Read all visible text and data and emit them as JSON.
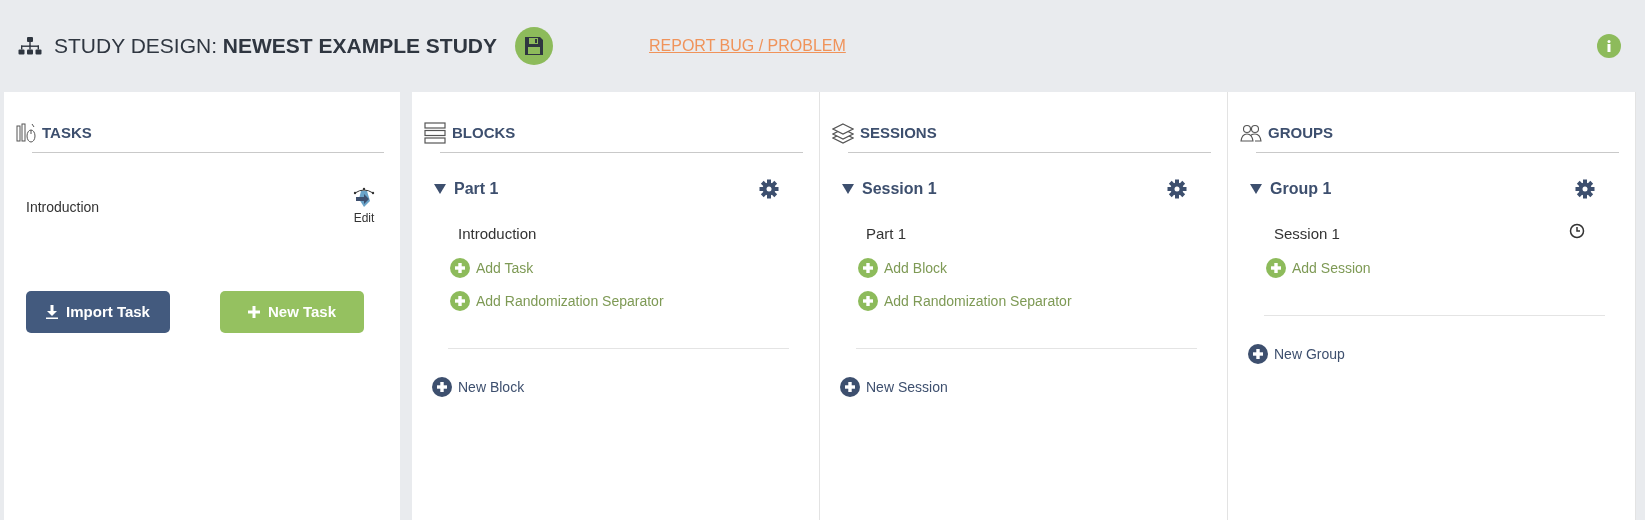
{
  "header": {
    "title": "STUDY DESIGN: **NEWEST EXAMPLE STUDY**",
    "report_link": "REPORT BUG / PROBLEM"
  },
  "tasks_panel": {
    "title": "TASKS",
    "tasks": [
      {
        "name": "Introduction",
        "edit_label": "Edit"
      }
    ],
    "buttons": [
      {
        "kind": "import",
        "label": "Import Task"
      },
      {
        "kind": "new",
        "label": "New Task"
      }
    ]
  },
  "panels": [
    {
      "kind": "blocks",
      "title": "BLOCKS",
      "items": [
        {
          "title": "Part 1",
          "expanded": true,
          "children": [
            {
              "label": "Introduction"
            }
          ],
          "add_actions": [
            "Add Task",
            "Add Randomization Separator"
          ]
        }
      ],
      "new_label": "New Block"
    },
    {
      "kind": "sessions",
      "title": "SESSIONS",
      "items": [
        {
          "title": "Session 1",
          "expanded": true,
          "children": [
            {
              "label": "Part 1"
            }
          ],
          "add_actions": [
            "Add Block",
            "Add Randomization Separator"
          ]
        }
      ],
      "new_label": "New Session"
    },
    {
      "kind": "groups",
      "title": "GROUPS",
      "items": [
        {
          "title": "Group 1",
          "expanded": true,
          "children": [
            {
              "label": "Session 1"
            }
          ],
          "add_actions": [
            "Add Session"
          ]
        }
      ],
      "new_label": "New Group"
    }
  ]
}
